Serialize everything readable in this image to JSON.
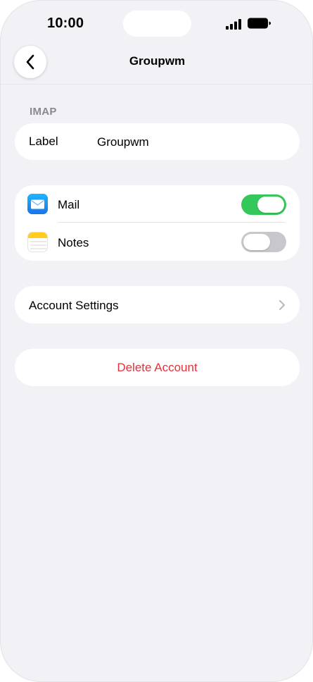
{
  "status_bar": {
    "time": "10:00"
  },
  "nav": {
    "title": "Groupwm",
    "back_icon": "chevron-left-icon"
  },
  "section": {
    "header": "IMAP"
  },
  "label_row": {
    "label": "Label",
    "value": "Groupwm"
  },
  "apps": [
    {
      "name": "Mail",
      "enabled": true,
      "icon": "mail-icon"
    },
    {
      "name": "Notes",
      "enabled": false,
      "icon": "notes-icon"
    }
  ],
  "account_settings": {
    "label": "Account Settings",
    "chevron_icon": "chevron-right-icon"
  },
  "delete": {
    "label": "Delete Account"
  },
  "colors": {
    "background": "#f2f1f6",
    "toggle_on": "#34c759",
    "toggle_off": "#c8c8cc",
    "destructive": "#e0323c",
    "mail_blue": "#1e8cf3"
  }
}
